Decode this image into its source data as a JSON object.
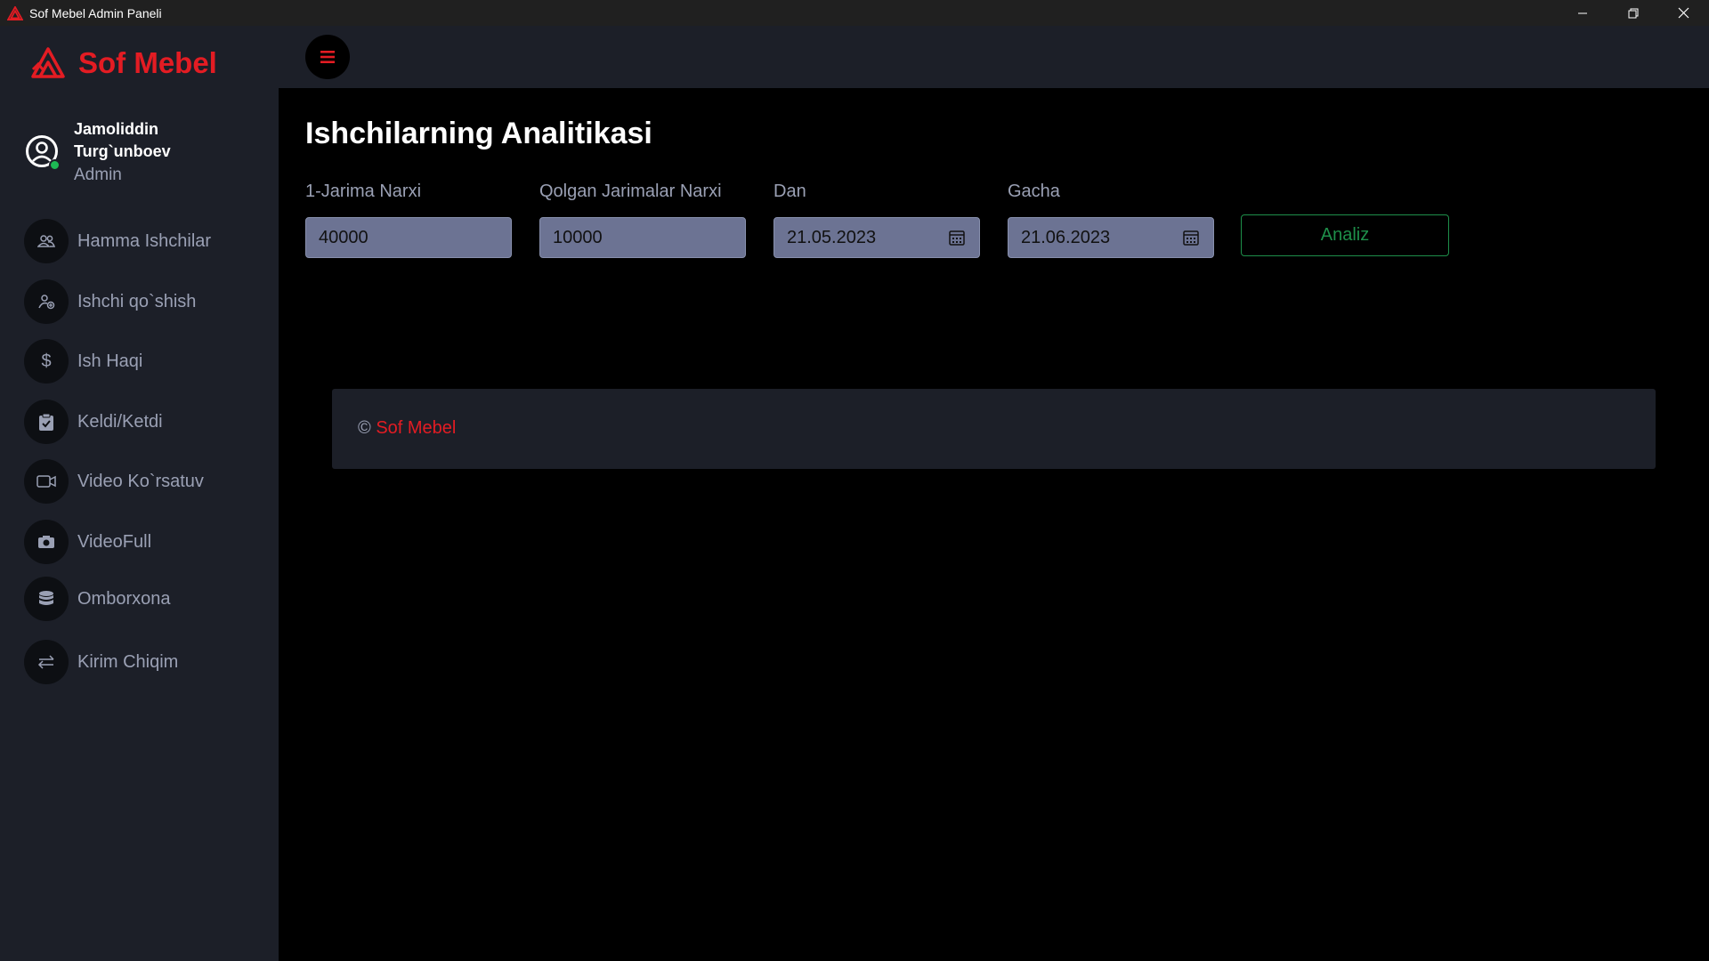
{
  "window": {
    "title": "Sof Mebel Admin Paneli"
  },
  "brand": {
    "name": "Sof Mebel",
    "color": "#e31c23"
  },
  "user": {
    "name": "Jamoliddin Turg`unboev",
    "role": "Admin",
    "status_color": "#1db954"
  },
  "nav": {
    "items": [
      {
        "label": "Hamma Ishchilar",
        "icon": "users-icon"
      },
      {
        "label": "Ishchi qo`shish",
        "icon": "user-add-icon"
      },
      {
        "label": "Ish Haqi",
        "icon": "dollar-icon"
      },
      {
        "label": "Keldi/Ketdi",
        "icon": "clipboard-check-icon"
      },
      {
        "label": "Video Ko`rsatuv",
        "icon": "video-camera-icon"
      },
      {
        "label": "VideoFull",
        "icon": "camera-icon"
      },
      {
        "label": "Omborxona",
        "icon": "database-icon"
      },
      {
        "label": "Kirim Chiqim",
        "icon": "swap-arrows-icon"
      }
    ]
  },
  "main": {
    "title": "Ishchilarning Analitikasi",
    "fields": [
      {
        "label": "1-Jarima Narxi",
        "value": "40000"
      },
      {
        "label": "Qolgan Jarimalar Narxi",
        "value": "10000"
      },
      {
        "label": "Dan",
        "value": "21.05.2023"
      },
      {
        "label": "Gacha",
        "value": "21.06.2023"
      }
    ],
    "analyze_button": "Analiz",
    "accent_green": "#1e8f4a"
  },
  "footer": {
    "copyright_symbol": "©",
    "brand": "Sof Mebel"
  }
}
